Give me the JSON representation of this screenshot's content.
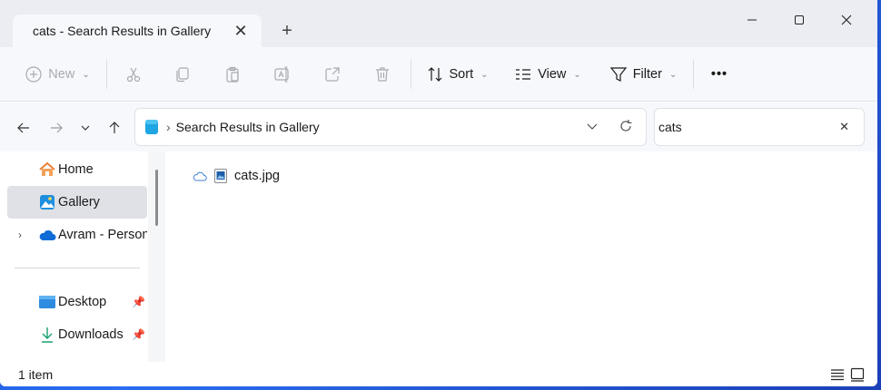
{
  "tab": {
    "title": "cats - Search Results in Gallery",
    "close": "✕",
    "new_tab": "+"
  },
  "window_controls": {
    "minimize": "minimize",
    "maximize": "maximize",
    "close": "close"
  },
  "toolbar": {
    "new_label": "New",
    "sort_label": "Sort",
    "view_label": "View",
    "filter_label": "Filter",
    "more_label": "•••"
  },
  "address": {
    "separator": "›",
    "location": "Search Results in Gallery"
  },
  "search": {
    "value": "cats",
    "clear": "✕"
  },
  "sidebar": {
    "items": [
      {
        "label": "Home"
      },
      {
        "label": "Gallery"
      },
      {
        "label": "Avram - Personal"
      },
      {
        "label": "Desktop"
      },
      {
        "label": "Downloads"
      }
    ]
  },
  "files": [
    {
      "name": "cats.jpg",
      "status_icon": "cloud-icon"
    }
  ],
  "status": {
    "item_count": "1 item"
  },
  "colors": {
    "accent": "#0a64d6",
    "selection": "#dfe1e6",
    "desktop_blue": "#3a8fd8"
  }
}
